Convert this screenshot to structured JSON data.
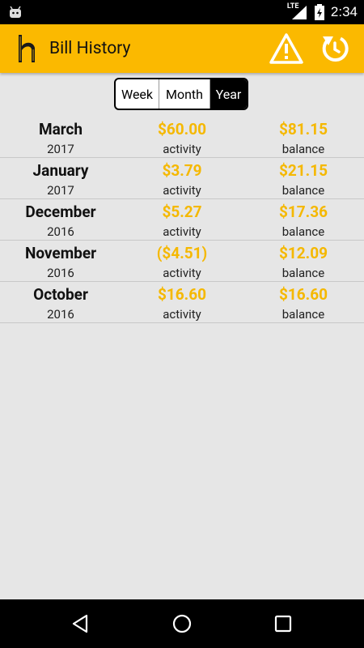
{
  "status_bar": {
    "time": "2:34",
    "network": "LTE"
  },
  "app_bar": {
    "title": "Bill History",
    "logo_icon": "h-logo-icon",
    "actions": [
      "warning-icon",
      "refresh-icon"
    ]
  },
  "period_selector": {
    "options": [
      "Week",
      "Month",
      "Year"
    ],
    "selected": "Year"
  },
  "history": {
    "activity_label": "activity",
    "balance_label": "balance",
    "rows": [
      {
        "month": "March",
        "year": "2017",
        "activity": "$60.00",
        "balance": "$81.15"
      },
      {
        "month": "January",
        "year": "2017",
        "activity": "$3.79",
        "balance": "$21.15"
      },
      {
        "month": "December",
        "year": "2016",
        "activity": "$5.27",
        "balance": "$17.36"
      },
      {
        "month": "November",
        "year": "2016",
        "activity": "($4.51)",
        "balance": "$12.09"
      },
      {
        "month": "October",
        "year": "2016",
        "activity": "$16.60",
        "balance": "$16.60"
      }
    ]
  },
  "colors": {
    "accent": "#fbb900",
    "amount": "#f5b800",
    "background": "#e6e6e6"
  },
  "nav_bar": {
    "icons": [
      "back-icon",
      "home-icon",
      "recents-icon"
    ]
  }
}
